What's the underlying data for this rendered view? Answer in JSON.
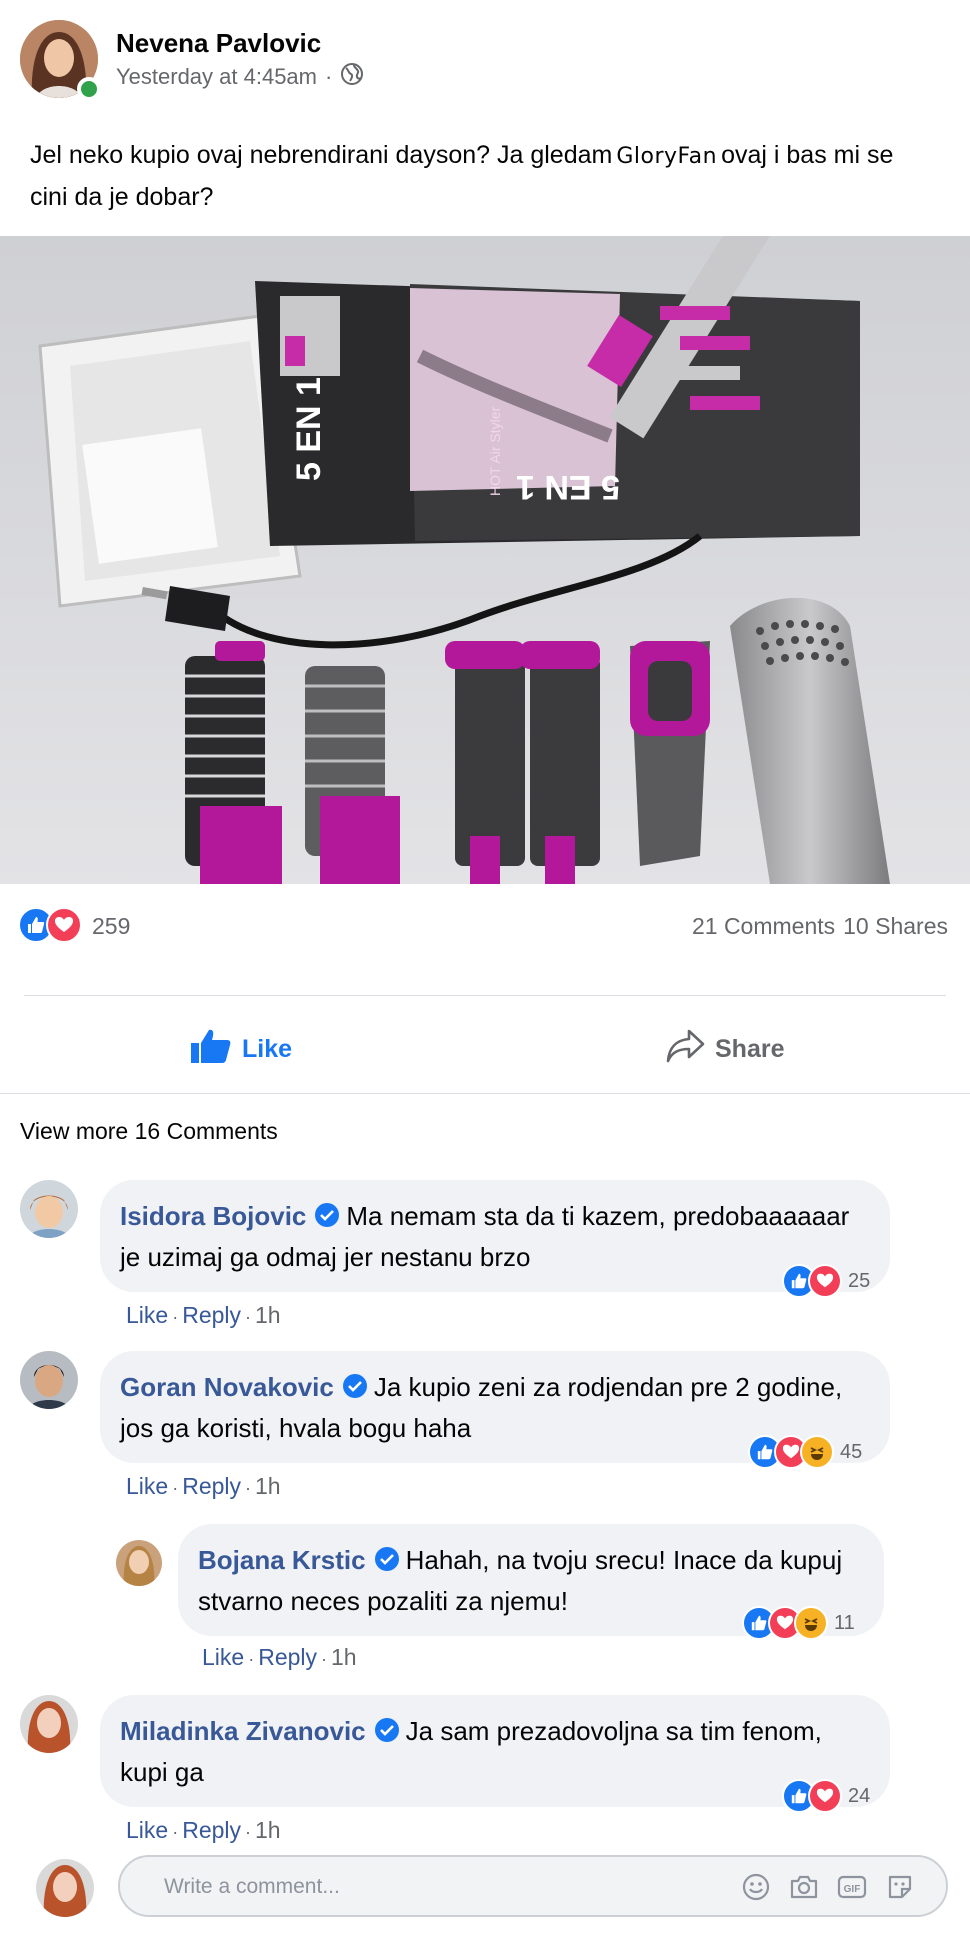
{
  "post": {
    "author": "Nevena Pavlovic",
    "timestamp": "Yesterday at 4:45am",
    "privacy_separator": "·",
    "text_before": "Jel neko kupio ovaj nebrendirani dayson? Ja gledam",
    "text_brand": "GloryFan",
    "text_after": "ovaj i bas mi se cini da je dobar?",
    "photo_alt": "5 in 1 Hot Air Styler"
  },
  "stats": {
    "reaction_count": "259",
    "comments": "21 Comments",
    "shares": "10 Shares"
  },
  "actions": {
    "like_label": "Like",
    "share_label": "Share"
  },
  "view_more": "View more 16 Comments",
  "comments": [
    {
      "author": "Isidora Bojovic",
      "text": "Ma nemam sta da ti kazem, predobaaaaaar je uzimaj ga odmaj jer nestanu brzo",
      "reactions": [
        "like",
        "love"
      ],
      "count": "25",
      "like": "Like",
      "reply": "Reply",
      "time": "1h"
    },
    {
      "author": "Goran Novakovic",
      "text": "Ja kupio zeni za rodjendan pre 2 godine, jos ga koristi, hvala bogu haha",
      "reactions": [
        "like",
        "love",
        "haha"
      ],
      "count": "45",
      "like": "Like",
      "reply": "Reply",
      "time": "1h"
    },
    {
      "author": "Bojana Krstic",
      "text": "Hahah, na tvoju srecu! Inace da kupuj stvarno neces pozaliti za njemu!",
      "reactions": [
        "like",
        "love",
        "haha"
      ],
      "count": "11",
      "like": "Like",
      "reply": "Reply",
      "time": "1h"
    },
    {
      "author": "Miladinka Zivanovic",
      "text": "Ja sam prezadovoljna sa tim fenom, kupi ga",
      "reactions": [
        "like",
        "love"
      ],
      "count": "24",
      "like": "Like",
      "reply": "Reply",
      "time": "1h"
    }
  ],
  "composer": {
    "placeholder": "Write a comment..."
  },
  "colors": {
    "link_blue": "#385898",
    "fb_blue": "#1877f2",
    "love_red": "#f33e58",
    "haha_yellow": "#f7b125",
    "online_green": "#31a24c",
    "meta_gray": "#65676b"
  }
}
